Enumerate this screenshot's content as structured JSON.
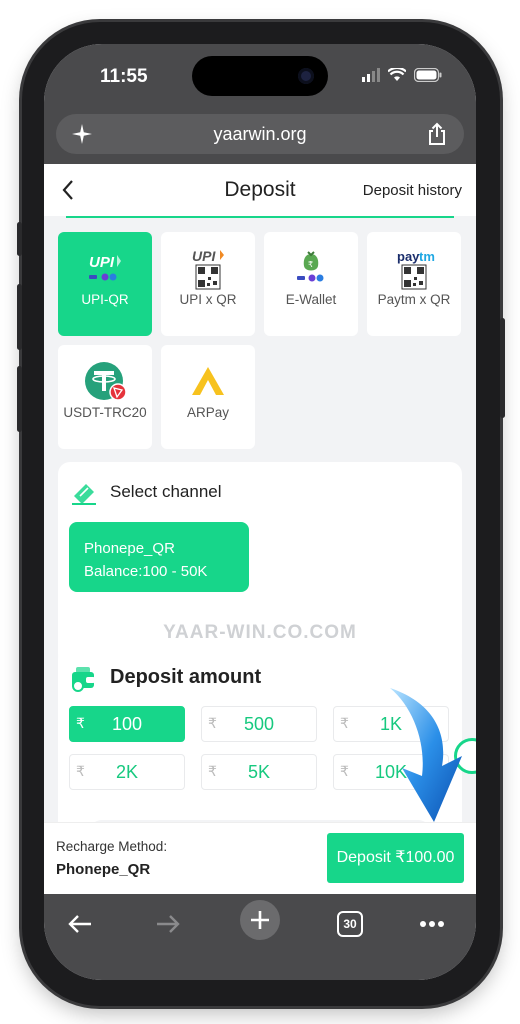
{
  "status_bar": {
    "time": "11:55"
  },
  "browser": {
    "url": "yaarwin.org",
    "tab_count": "30"
  },
  "header": {
    "title": "Deposit",
    "history_label": "Deposit history"
  },
  "methods": [
    {
      "label": "UPI-QR",
      "active": true,
      "icon": "upi-qr-icon"
    },
    {
      "label": "UPI x QR",
      "active": false,
      "icon": "upi-x-qr-icon"
    },
    {
      "label": "E-Wallet",
      "active": false,
      "icon": "e-wallet-icon"
    },
    {
      "label": "Paytm x QR",
      "active": false,
      "icon": "paytm-qr-icon"
    },
    {
      "label": "USDT-TRC20",
      "active": false,
      "icon": "tether-icon"
    },
    {
      "label": "ARPay",
      "active": false,
      "icon": "arpay-icon"
    }
  ],
  "channel": {
    "title": "Select channel",
    "name": "Phonepe_QR",
    "balance": "Balance:100 - 50K"
  },
  "watermark": "YAAR-WIN.CO.COM",
  "amount": {
    "title": "Deposit amount",
    "currency_symbol": "₹",
    "options": [
      {
        "value": "100",
        "active": true
      },
      {
        "value": "500",
        "active": false
      },
      {
        "value": "1K",
        "active": false
      },
      {
        "value": "2K",
        "active": false
      },
      {
        "value": "5K",
        "active": false
      },
      {
        "value": "10K",
        "active": false
      }
    ]
  },
  "bottom": {
    "recharge_label": "Recharge Method:",
    "recharge_value": "Phonepe_QR",
    "deposit_button": "Deposit ₹100.00"
  },
  "colors": {
    "accent": "#17d68a",
    "chrome": "#4a4a4c"
  }
}
